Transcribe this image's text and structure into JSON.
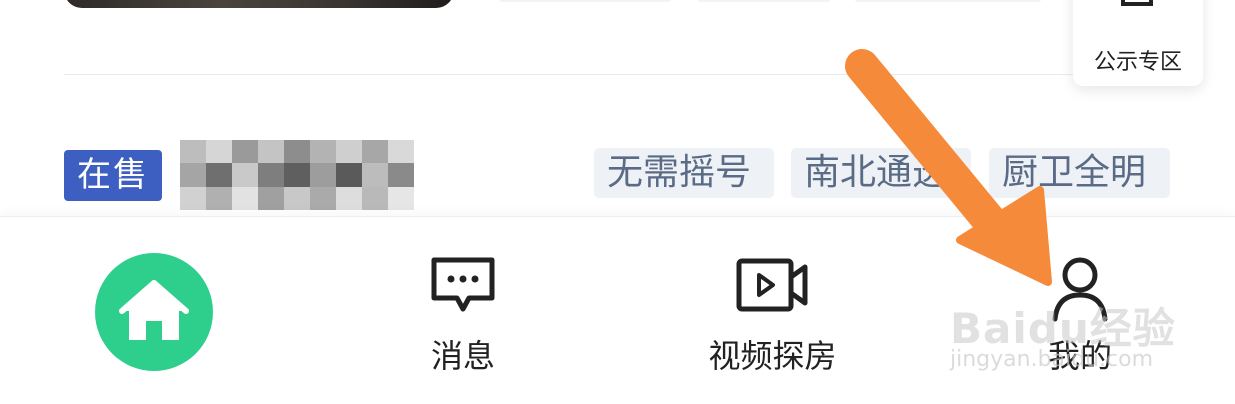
{
  "notice": {
    "label": "公示专区",
    "icon": "document-icon"
  },
  "listing": {
    "status_badge": "在售",
    "tags": [
      "无需摇号",
      "南北通透",
      "厨卫全明"
    ]
  },
  "nav": {
    "home_icon": "home-icon",
    "items": [
      {
        "label": "消息",
        "icon": "message-icon"
      },
      {
        "label": "视频探房",
        "icon": "video-icon"
      },
      {
        "label": "我的",
        "icon": "user-icon"
      }
    ]
  },
  "watermark": {
    "brand": "Baidu经验",
    "url": "jingyan.baidu.com"
  },
  "colors": {
    "home_green": "#2ecf8d",
    "badge_blue": "#3d5fc2",
    "tag_bg": "#eef1f6",
    "tag_text": "#5a6b86",
    "arrow_orange": "#f58a3a"
  }
}
